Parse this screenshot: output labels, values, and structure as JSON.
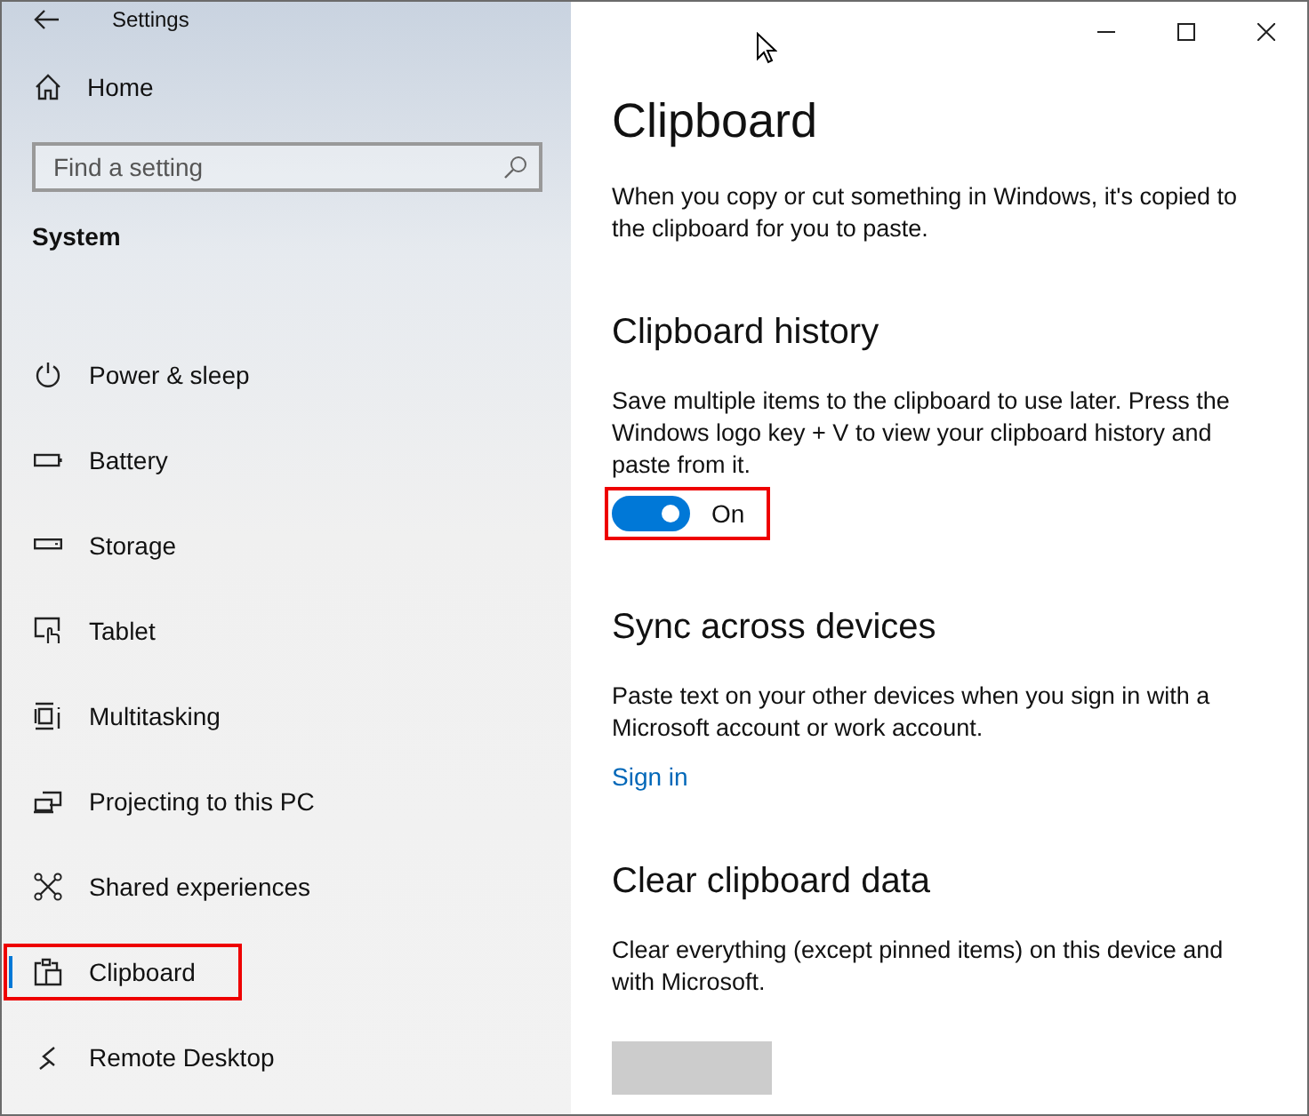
{
  "window": {
    "title": "Settings"
  },
  "sidebar": {
    "home": "Home",
    "search": {
      "placeholder": "Find a setting"
    },
    "section": "System",
    "items": [
      {
        "label": "Power & sleep",
        "kind": "power",
        "selected": false,
        "highlighted": false
      },
      {
        "label": "Battery",
        "kind": "battery",
        "selected": false,
        "highlighted": false
      },
      {
        "label": "Storage",
        "kind": "storage",
        "selected": false,
        "highlighted": false
      },
      {
        "label": "Tablet",
        "kind": "tablet",
        "selected": false,
        "highlighted": false
      },
      {
        "label": "Multitasking",
        "kind": "multitask",
        "selected": false,
        "highlighted": false
      },
      {
        "label": "Projecting to this PC",
        "kind": "project",
        "selected": false,
        "highlighted": false
      },
      {
        "label": "Shared experiences",
        "kind": "shared",
        "selected": false,
        "highlighted": false
      },
      {
        "label": "Clipboard",
        "kind": "clipboard",
        "selected": true,
        "highlighted": true
      },
      {
        "label": "Remote Desktop",
        "kind": "remote",
        "selected": false,
        "highlighted": false
      }
    ]
  },
  "content": {
    "title": "Clipboard",
    "intro": "When you copy or cut something in Windows, it's copied to the clipboard for you to paste.",
    "sections": [
      {
        "kind": "toggle",
        "heading": "Clipboard history",
        "text": "Save multiple items to the clipboard to use later. Press the Windows logo key + V to view your clipboard history and paste from it.",
        "on": true,
        "state_label": "On",
        "highlighted": true
      },
      {
        "kind": "link",
        "heading": "Sync across devices",
        "text": "Paste text on your other devices when you sign in with a Microsoft account or work account.",
        "link": "Sign in"
      },
      {
        "kind": "button",
        "heading": "Clear clipboard data",
        "text": "Clear everything (except pinned items) on this device and with Microsoft."
      }
    ]
  }
}
